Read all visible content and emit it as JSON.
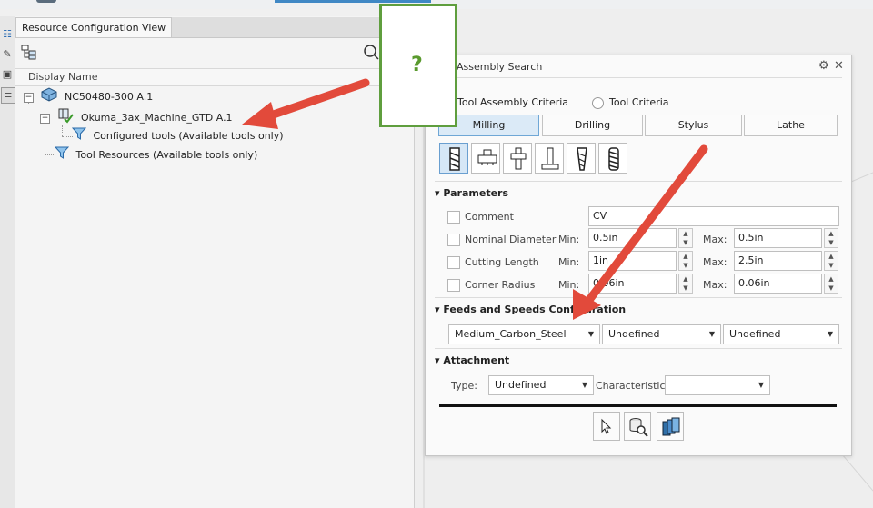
{
  "left_panel": {
    "tab_title": "Resource Configuration View",
    "column_header": "Display Name",
    "tree": [
      {
        "label": "NC50480-300 A.1",
        "expander": "−"
      },
      {
        "label": "Okuma_3ax_Machine_GTD A.1",
        "expander": "−"
      },
      {
        "label": "Configured tools (Available tools only)"
      },
      {
        "label": "Tool Resources (Available tools only)"
      }
    ]
  },
  "callout": {
    "text": "?",
    "color": "#5f9e3e"
  },
  "dialog": {
    "title": "Assembly Search",
    "radio_tool_assembly": "Tool Assembly Criteria",
    "radio_tool": "Tool Criteria",
    "segments": [
      "Milling",
      "Drilling",
      "Stylus",
      "Lathe"
    ],
    "active_segment": "Milling",
    "tool_type_icons": [
      "end-mill-icon",
      "face-mill-icon",
      "t-slot-icon",
      "boring-icon",
      "taper-mill-icon",
      "thread-mill-icon"
    ],
    "parameters": {
      "header": "Parameters",
      "comment_label": "Comment",
      "comment_value": "CV",
      "min_label": "Min:",
      "max_label": "Max:",
      "rows": [
        {
          "label": "Nominal Diameter",
          "min": "0.5in",
          "max": "0.5in"
        },
        {
          "label": "Cutting Length",
          "min": "1in",
          "max": "2.5in"
        },
        {
          "label": "Corner Radius",
          "min": "0.06in",
          "max": "0.06in"
        }
      ]
    },
    "feeds": {
      "header": "Feeds and Speeds Configuration",
      "dropdowns": [
        "Medium_Carbon_Steel",
        "Undefined",
        "Undefined"
      ]
    },
    "attachment": {
      "header": "Attachment",
      "type_label": "Type:",
      "type_value": "Undefined",
      "characteristic_label": "Characteristic:",
      "characteristic_value": ""
    },
    "buttons": [
      "select-cursor-icon",
      "database-search-icon",
      "tool-stack-icon"
    ]
  },
  "colors": {
    "arrow": "#e24a3b",
    "accent": "#3f88c5",
    "active_segment": "#dbeaf7"
  }
}
